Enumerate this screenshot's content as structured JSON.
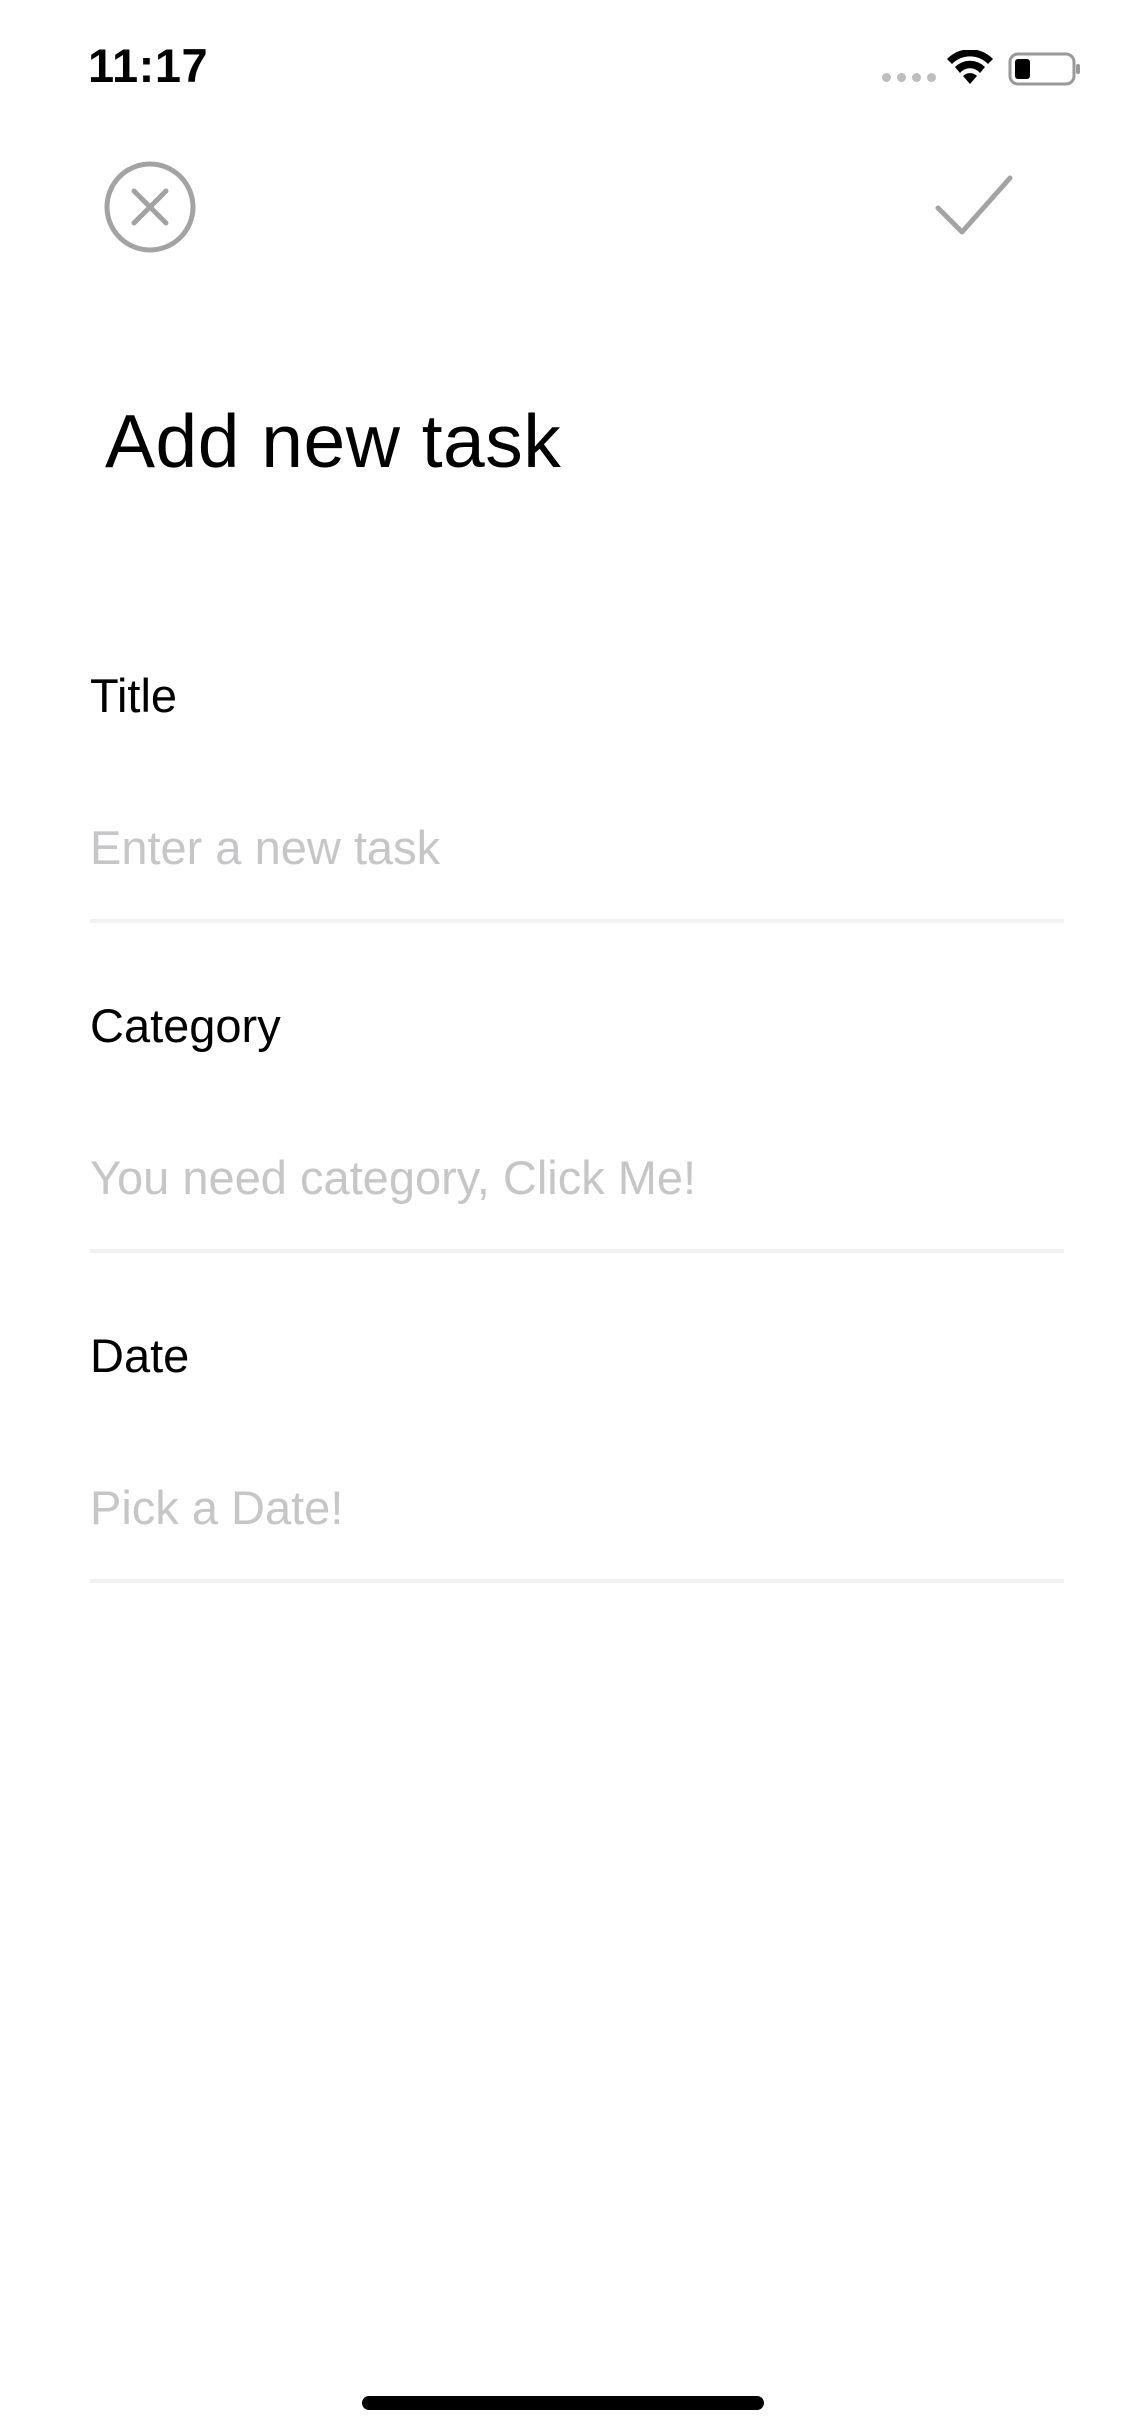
{
  "status_bar": {
    "time": "11:17"
  },
  "nav": {
    "close_icon": "close-circle-icon",
    "confirm_icon": "checkmark-icon",
    "icon_color": "#a3a3a3"
  },
  "page": {
    "title": "Add new task"
  },
  "form": {
    "title": {
      "label": "Title",
      "value": "",
      "placeholder": "Enter a new task"
    },
    "category": {
      "label": "Category",
      "value": "",
      "placeholder": "You need category, Click Me!"
    },
    "date": {
      "label": "Date",
      "value": "",
      "placeholder": "Pick a Date!"
    }
  }
}
